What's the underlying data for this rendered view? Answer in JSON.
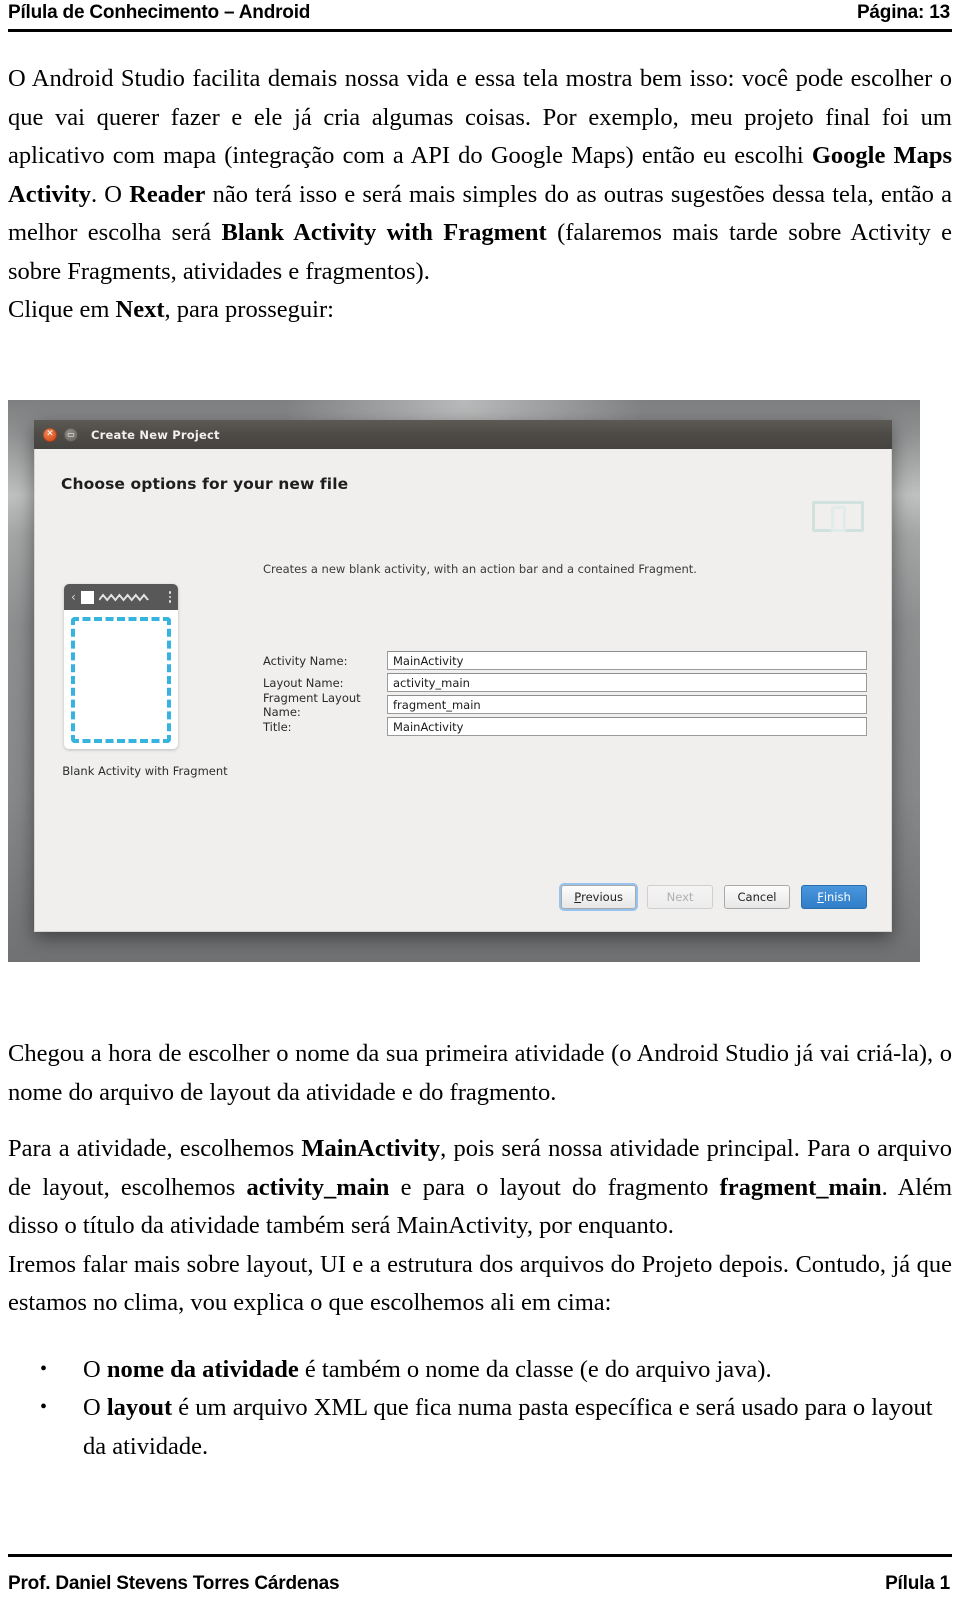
{
  "header": {
    "title": "Pílula de Conhecimento – Android",
    "page_label": "Página: 13"
  },
  "footer": {
    "author": "Prof. Daniel Stevens Torres Cárdenas",
    "right_label": "Pílula 1"
  },
  "body": {
    "para1_a": "O Android Studio facilita demais nossa vida e essa tela mostra bem isso: você pode escolher o que vai querer fazer e ele já cria algumas coisas. Por exemplo, meu projeto final foi um aplicativo com mapa (integração com a API do Google Maps) então eu escolhi ",
    "para1_b": "Google Maps Activity",
    "para1_c": ". O ",
    "para1_d": "Reader",
    "para1_e": " não terá isso e será mais simples do as outras sugestões dessa tela, então a melhor escolha será ",
    "para1_f": "Blank Activity with Fragment",
    "para1_g": " (falaremos mais tarde sobre Activity e sobre Fragments, atividades e fragmentos).",
    "para2_a": "Clique em ",
    "para2_b": "Next",
    "para2_c": ", para prosseguir:",
    "para3": "Chegou a hora de escolher o nome da sua primeira atividade (o Android Studio já vai criá-la), o nome do arquivo de layout da atividade e do fragmento.",
    "para4_a": "Para a atividade, escolhemos ",
    "para4_b": "MainActivity",
    "para4_c": ", pois será nossa atividade principal. Para o arquivo de layout, escolhemos ",
    "para4_d": "activity_main",
    "para4_e": " e para o layout do fragmento ",
    "para4_f": "fragment_main",
    "para4_g": ". Além disso o título da atividade também será MainActivity, por enquanto.",
    "para5": "Iremos falar mais sobre layout, UI e a estrutura dos arquivos do Projeto depois. Contudo, já que estamos no clima, vou explica o que escolhemos ali em cima:",
    "bullet1_a": "O ",
    "bullet1_b": "nome da atividade",
    "bullet1_c": " é também o nome da classe (e do arquivo java).",
    "bullet2_a": "O ",
    "bullet2_b": "layout",
    "bullet2_c": " é um arquivo XML que fica numa pasta específica e será usado para o layout da atividade."
  },
  "screenshot": {
    "window_title": "Create New Project",
    "close_glyph": "✕",
    "minimize_glyph": "▭",
    "heading": "Choose options for your new file",
    "description": "Creates a new blank activity, with an action bar and a contained Fragment.",
    "template_caption": "Blank Activity with Fragment",
    "fields": [
      {
        "label": "Activity Name:",
        "value": "MainActivity"
      },
      {
        "label": "Layout Name:",
        "value": "activity_main"
      },
      {
        "label": "Fragment Layout Name:",
        "value": "fragment_main"
      },
      {
        "label": "Title:",
        "value": "MainActivity"
      }
    ],
    "buttons": {
      "previous": "Previous",
      "next": "Next",
      "cancel": "Cancel",
      "finish": "Finish"
    },
    "colors": {
      "dashed_fragment": "#35b4e0",
      "primary_button": "#2f7ec8",
      "focus_ring": "#96c4ee",
      "titlebar": "#4e4b47",
      "close_button": "#d9521f"
    }
  }
}
